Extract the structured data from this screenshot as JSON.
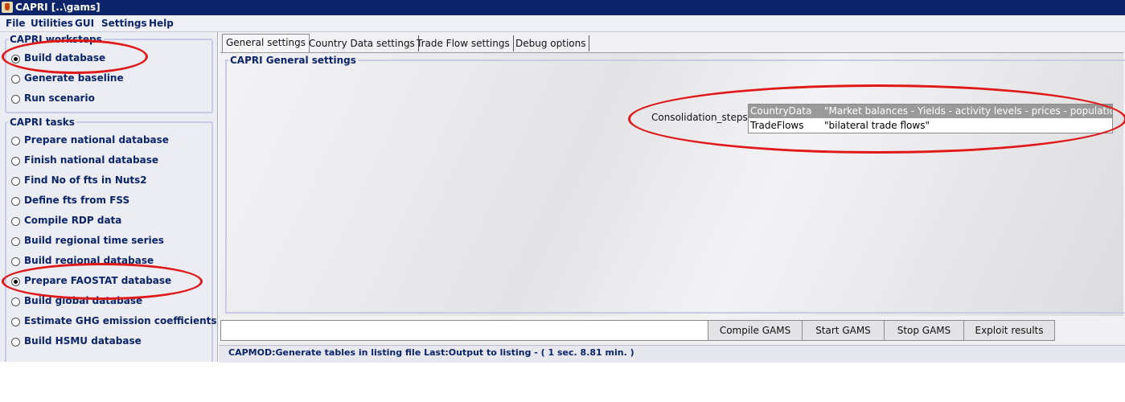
{
  "window": {
    "title": "CAPRI [..\\gams]",
    "icon": "java-cup-icon"
  },
  "menu": [
    "File",
    "Utilities",
    "GUI",
    "Settings",
    "Help"
  ],
  "workstepsPanel": {
    "legend": "CAPRI worksteps",
    "items": [
      {
        "label": "Build database",
        "selected": true
      },
      {
        "label": "Generate baseline",
        "selected": false
      },
      {
        "label": "Run scenario",
        "selected": false
      }
    ]
  },
  "tasksPanel": {
    "legend": "CAPRI tasks",
    "items": [
      {
        "label": "Prepare national database",
        "selected": false
      },
      {
        "label": "Finish national database",
        "selected": false
      },
      {
        "label": "Find No of fts in Nuts2",
        "selected": false
      },
      {
        "label": "Define fts from FSS",
        "selected": false
      },
      {
        "label": "Compile RDP data",
        "selected": false
      },
      {
        "label": "Build regional time series",
        "selected": false
      },
      {
        "label": "Build regional database",
        "selected": false
      },
      {
        "label": "Prepare FAOSTAT database",
        "selected": true
      },
      {
        "label": "Build global database",
        "selected": false
      },
      {
        "label": "Estimate GHG emission coefficients",
        "selected": false
      },
      {
        "label": "Build HSMU database",
        "selected": false
      }
    ]
  },
  "tabs": [
    {
      "label": "General settings",
      "active": true
    },
    {
      "label": "Country Data settings",
      "active": false
    },
    {
      "label": "Trade Flow settings",
      "active": false
    },
    {
      "label": "Debug options",
      "active": false
    }
  ],
  "generalSettings": {
    "legend": "CAPRI General settings",
    "consolidationLabel": "Consolidation_steps",
    "consolidationRows": [
      {
        "key": "CountryData",
        "value": "\"Market balances - Yields - activity levels - prices - population\"",
        "selected": true
      },
      {
        "key": "TradeFlows",
        "value": "\"bilateral trade flows\"",
        "selected": false
      }
    ]
  },
  "actions": {
    "message": "",
    "buttons": [
      "Compile GAMS",
      "Start GAMS",
      "Stop GAMS",
      "Exploit results"
    ]
  },
  "status": {
    "text": "CAPMOD:Generate tables in listing file Last:Output to listing - (     1 sec.   8.81 min. )"
  },
  "colors": {
    "titlebar": "#0b246a",
    "accentText": "#0b246a",
    "highlightOutline": "#e01818",
    "selectedRow": "#9a9a9a"
  }
}
